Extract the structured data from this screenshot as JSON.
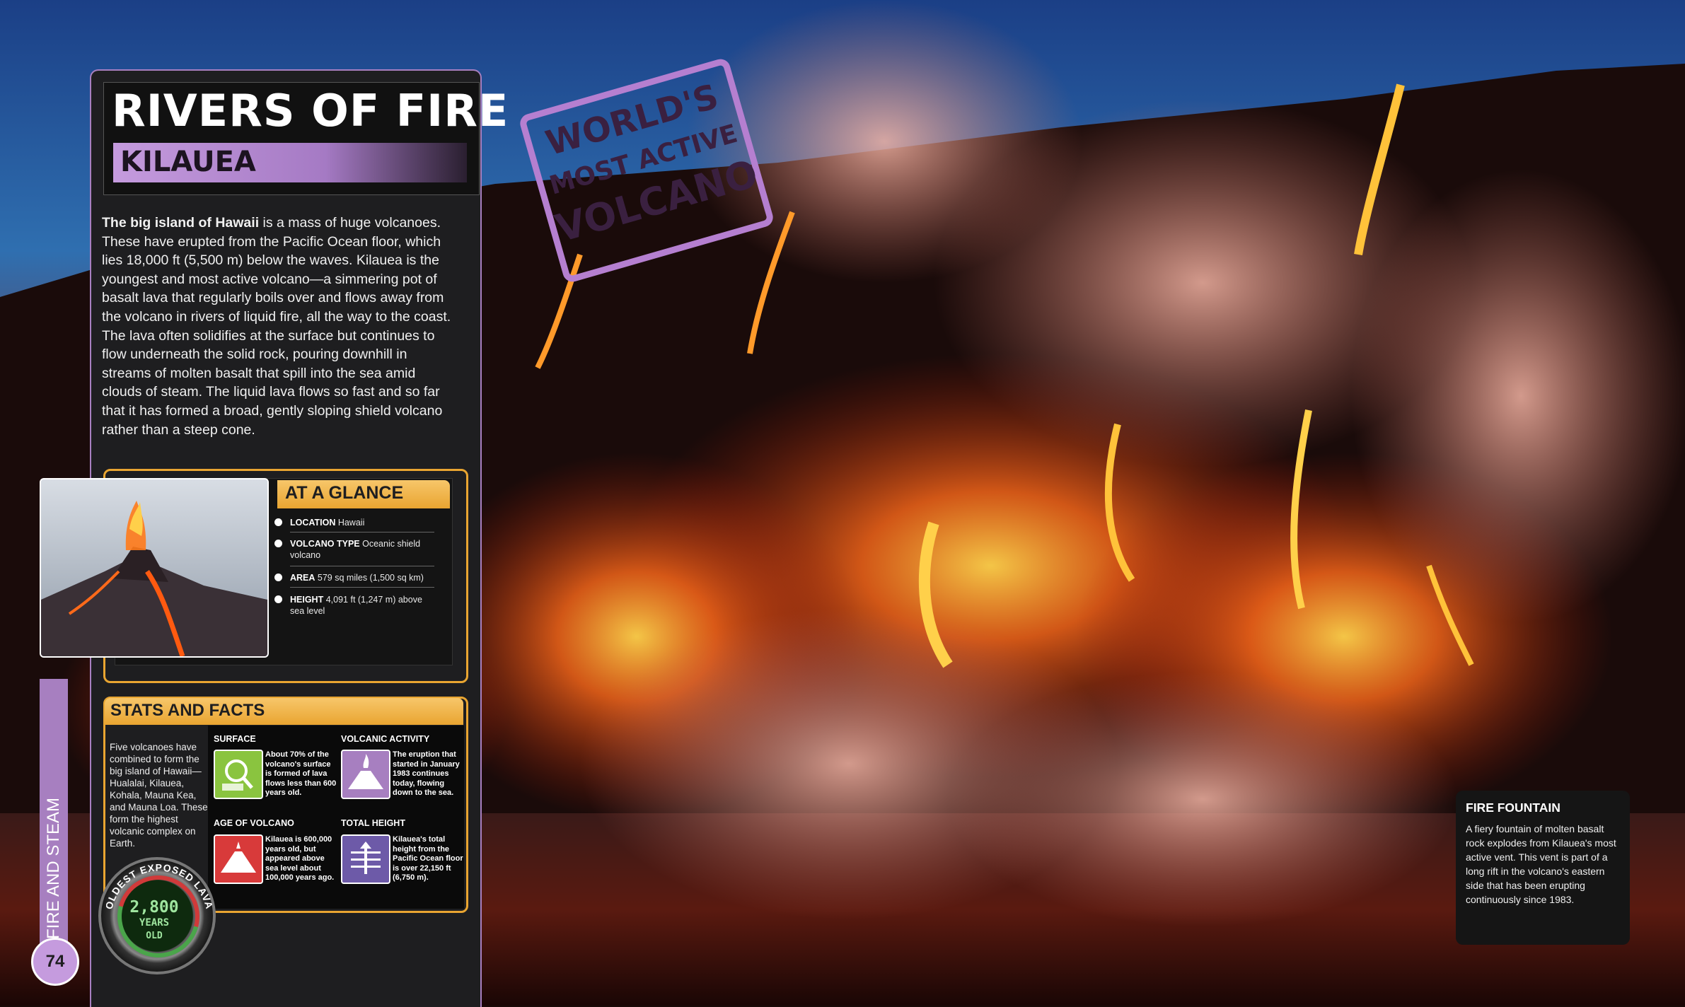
{
  "page": {
    "title": "RIVERS OF FIRE",
    "subtitle": "KILAUEA",
    "intro_bold": "The big island of Hawaii",
    "intro_text": " is a mass of huge volcanoes. These have erupted from the Pacific Ocean floor, which lies 18,000 ft (5,500 m) below the waves. Kilauea is the youngest and most active volcano—a simmering pot of basalt lava that regularly boils over and flows away from the volcano in rivers of liquid fire, all the way to the coast. The lava often solidifies at the surface but continues to flow underneath the solid rock, pouring downhill in streams of molten basalt that spill into the sea amid clouds of steam. The liquid lava flows so fast and so far that it has formed a broad, gently sloping shield volcano rather than a steep cone.",
    "section_tab": "FIRE AND STEAM",
    "page_number": "74"
  },
  "stamp": {
    "line1": "WORLD'S",
    "line2": "MOST ACTIVE",
    "line3": "VOLCANO"
  },
  "at_a_glance": {
    "title": "AT A GLANCE",
    "items": [
      {
        "label": "LOCATION",
        "value": "Hawaii"
      },
      {
        "label": "VOLCANO TYPE",
        "value": "Oceanic shield volcano"
      },
      {
        "label": "AREA",
        "value": "579 sq miles (1,500 sq km)"
      },
      {
        "label": "HEIGHT",
        "value": "4,091 ft (1,247 m) above sea level"
      }
    ]
  },
  "stats_and_facts": {
    "title": "STATS AND FACTS",
    "intro": "Five volcanoes have combined to form the big island of Hawaii—Hualalai, Kilauea, Kohala, Mauna Kea, and Mauna Loa. These form the highest volcanic complex on Earth.",
    "facts": [
      {
        "label": "SURFACE",
        "text": "About 70% of the volcano's surface is formed of lava flows less than 600 years old.",
        "icon": "map-magnifier-icon",
        "color": "#8ac43f"
      },
      {
        "label": "VOLCANIC ACTIVITY",
        "text": "The eruption that started in January 1983 continues today, flowing down to the sea.",
        "icon": "erupting-volcano-icon",
        "color": "#a77fc0"
      },
      {
        "label": "AGE OF VOLCANO",
        "text": "Kilauea is 600,000 years old, but appeared above sea level about 100,000 years ago.",
        "icon": "volcano-cone-icon",
        "color": "#d83a3a"
      },
      {
        "label": "TOTAL HEIGHT",
        "text": "Kilauea's total height from the Pacific Ocean floor is over 22,150 ft (6,750 m).",
        "icon": "height-chart-icon",
        "color": "#6d5aa8"
      }
    ],
    "gauge": {
      "label": "OLDEST EXPOSED LAVA",
      "value": "2,800",
      "unit_line1": "YEARS",
      "unit_line2": "OLD"
    }
  },
  "caption": {
    "title": "FIRE FOUNTAIN",
    "text": "A fiery fountain of molten basalt rock explodes from Kilauea's most active vent. This vent is part of a long rift in the volcano's eastern side that has been erupting continuously since 1983."
  }
}
